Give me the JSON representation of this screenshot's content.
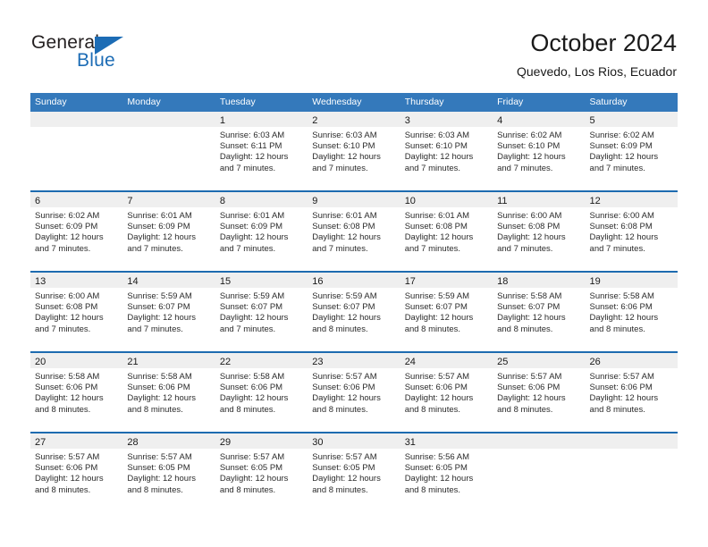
{
  "brand": {
    "name_part1": "General",
    "name_part2": "Blue",
    "logo_color": "#1c6cb5"
  },
  "header": {
    "title": "October 2024",
    "subtitle": "Quevedo, Los Rios, Ecuador"
  },
  "colors": {
    "header_blue": "#3479bb",
    "rule_blue": "#1d6bb0",
    "day_band_gray": "#efefef",
    "text": "#2b2b2b"
  },
  "weekdays": [
    "Sunday",
    "Monday",
    "Tuesday",
    "Wednesday",
    "Thursday",
    "Friday",
    "Saturday"
  ],
  "weeks": [
    [
      {
        "day": "",
        "sunrise": "",
        "sunset": "",
        "daylight1": "",
        "daylight2": ""
      },
      {
        "day": "",
        "sunrise": "",
        "sunset": "",
        "daylight1": "",
        "daylight2": ""
      },
      {
        "day": "1",
        "sunrise": "Sunrise: 6:03 AM",
        "sunset": "Sunset: 6:11 PM",
        "daylight1": "Daylight: 12 hours",
        "daylight2": "and 7 minutes."
      },
      {
        "day": "2",
        "sunrise": "Sunrise: 6:03 AM",
        "sunset": "Sunset: 6:10 PM",
        "daylight1": "Daylight: 12 hours",
        "daylight2": "and 7 minutes."
      },
      {
        "day": "3",
        "sunrise": "Sunrise: 6:03 AM",
        "sunset": "Sunset: 6:10 PM",
        "daylight1": "Daylight: 12 hours",
        "daylight2": "and 7 minutes."
      },
      {
        "day": "4",
        "sunrise": "Sunrise: 6:02 AM",
        "sunset": "Sunset: 6:10 PM",
        "daylight1": "Daylight: 12 hours",
        "daylight2": "and 7 minutes."
      },
      {
        "day": "5",
        "sunrise": "Sunrise: 6:02 AM",
        "sunset": "Sunset: 6:09 PM",
        "daylight1": "Daylight: 12 hours",
        "daylight2": "and 7 minutes."
      }
    ],
    [
      {
        "day": "6",
        "sunrise": "Sunrise: 6:02 AM",
        "sunset": "Sunset: 6:09 PM",
        "daylight1": "Daylight: 12 hours",
        "daylight2": "and 7 minutes."
      },
      {
        "day": "7",
        "sunrise": "Sunrise: 6:01 AM",
        "sunset": "Sunset: 6:09 PM",
        "daylight1": "Daylight: 12 hours",
        "daylight2": "and 7 minutes."
      },
      {
        "day": "8",
        "sunrise": "Sunrise: 6:01 AM",
        "sunset": "Sunset: 6:09 PM",
        "daylight1": "Daylight: 12 hours",
        "daylight2": "and 7 minutes."
      },
      {
        "day": "9",
        "sunrise": "Sunrise: 6:01 AM",
        "sunset": "Sunset: 6:08 PM",
        "daylight1": "Daylight: 12 hours",
        "daylight2": "and 7 minutes."
      },
      {
        "day": "10",
        "sunrise": "Sunrise: 6:01 AM",
        "sunset": "Sunset: 6:08 PM",
        "daylight1": "Daylight: 12 hours",
        "daylight2": "and 7 minutes."
      },
      {
        "day": "11",
        "sunrise": "Sunrise: 6:00 AM",
        "sunset": "Sunset: 6:08 PM",
        "daylight1": "Daylight: 12 hours",
        "daylight2": "and 7 minutes."
      },
      {
        "day": "12",
        "sunrise": "Sunrise: 6:00 AM",
        "sunset": "Sunset: 6:08 PM",
        "daylight1": "Daylight: 12 hours",
        "daylight2": "and 7 minutes."
      }
    ],
    [
      {
        "day": "13",
        "sunrise": "Sunrise: 6:00 AM",
        "sunset": "Sunset: 6:08 PM",
        "daylight1": "Daylight: 12 hours",
        "daylight2": "and 7 minutes."
      },
      {
        "day": "14",
        "sunrise": "Sunrise: 5:59 AM",
        "sunset": "Sunset: 6:07 PM",
        "daylight1": "Daylight: 12 hours",
        "daylight2": "and 7 minutes."
      },
      {
        "day": "15",
        "sunrise": "Sunrise: 5:59 AM",
        "sunset": "Sunset: 6:07 PM",
        "daylight1": "Daylight: 12 hours",
        "daylight2": "and 7 minutes."
      },
      {
        "day": "16",
        "sunrise": "Sunrise: 5:59 AM",
        "sunset": "Sunset: 6:07 PM",
        "daylight1": "Daylight: 12 hours",
        "daylight2": "and 8 minutes."
      },
      {
        "day": "17",
        "sunrise": "Sunrise: 5:59 AM",
        "sunset": "Sunset: 6:07 PM",
        "daylight1": "Daylight: 12 hours",
        "daylight2": "and 8 minutes."
      },
      {
        "day": "18",
        "sunrise": "Sunrise: 5:58 AM",
        "sunset": "Sunset: 6:07 PM",
        "daylight1": "Daylight: 12 hours",
        "daylight2": "and 8 minutes."
      },
      {
        "day": "19",
        "sunrise": "Sunrise: 5:58 AM",
        "sunset": "Sunset: 6:06 PM",
        "daylight1": "Daylight: 12 hours",
        "daylight2": "and 8 minutes."
      }
    ],
    [
      {
        "day": "20",
        "sunrise": "Sunrise: 5:58 AM",
        "sunset": "Sunset: 6:06 PM",
        "daylight1": "Daylight: 12 hours",
        "daylight2": "and 8 minutes."
      },
      {
        "day": "21",
        "sunrise": "Sunrise: 5:58 AM",
        "sunset": "Sunset: 6:06 PM",
        "daylight1": "Daylight: 12 hours",
        "daylight2": "and 8 minutes."
      },
      {
        "day": "22",
        "sunrise": "Sunrise: 5:58 AM",
        "sunset": "Sunset: 6:06 PM",
        "daylight1": "Daylight: 12 hours",
        "daylight2": "and 8 minutes."
      },
      {
        "day": "23",
        "sunrise": "Sunrise: 5:57 AM",
        "sunset": "Sunset: 6:06 PM",
        "daylight1": "Daylight: 12 hours",
        "daylight2": "and 8 minutes."
      },
      {
        "day": "24",
        "sunrise": "Sunrise: 5:57 AM",
        "sunset": "Sunset: 6:06 PM",
        "daylight1": "Daylight: 12 hours",
        "daylight2": "and 8 minutes."
      },
      {
        "day": "25",
        "sunrise": "Sunrise: 5:57 AM",
        "sunset": "Sunset: 6:06 PM",
        "daylight1": "Daylight: 12 hours",
        "daylight2": "and 8 minutes."
      },
      {
        "day": "26",
        "sunrise": "Sunrise: 5:57 AM",
        "sunset": "Sunset: 6:06 PM",
        "daylight1": "Daylight: 12 hours",
        "daylight2": "and 8 minutes."
      }
    ],
    [
      {
        "day": "27",
        "sunrise": "Sunrise: 5:57 AM",
        "sunset": "Sunset: 6:06 PM",
        "daylight1": "Daylight: 12 hours",
        "daylight2": "and 8 minutes."
      },
      {
        "day": "28",
        "sunrise": "Sunrise: 5:57 AM",
        "sunset": "Sunset: 6:05 PM",
        "daylight1": "Daylight: 12 hours",
        "daylight2": "and 8 minutes."
      },
      {
        "day": "29",
        "sunrise": "Sunrise: 5:57 AM",
        "sunset": "Sunset: 6:05 PM",
        "daylight1": "Daylight: 12 hours",
        "daylight2": "and 8 minutes."
      },
      {
        "day": "30",
        "sunrise": "Sunrise: 5:57 AM",
        "sunset": "Sunset: 6:05 PM",
        "daylight1": "Daylight: 12 hours",
        "daylight2": "and 8 minutes."
      },
      {
        "day": "31",
        "sunrise": "Sunrise: 5:56 AM",
        "sunset": "Sunset: 6:05 PM",
        "daylight1": "Daylight: 12 hours",
        "daylight2": "and 8 minutes."
      },
      {
        "day": "",
        "sunrise": "",
        "sunset": "",
        "daylight1": "",
        "daylight2": ""
      },
      {
        "day": "",
        "sunrise": "",
        "sunset": "",
        "daylight1": "",
        "daylight2": ""
      }
    ]
  ]
}
